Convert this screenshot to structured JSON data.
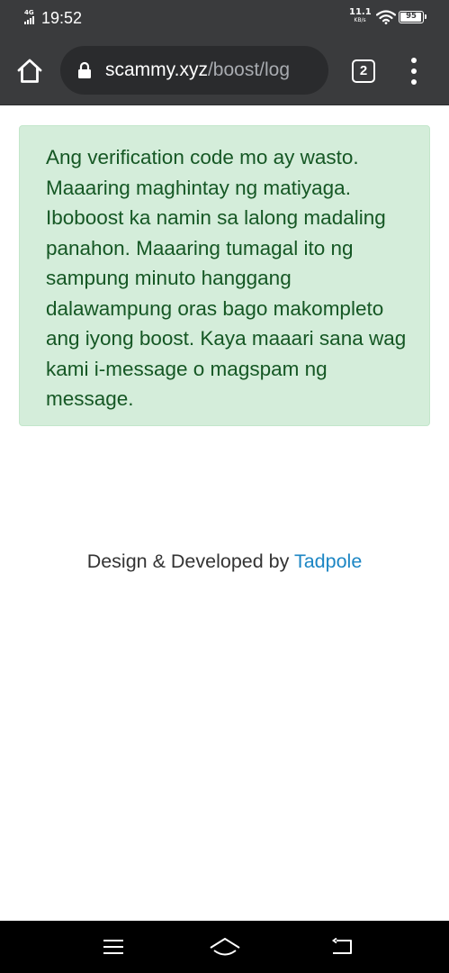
{
  "status_bar": {
    "network_type": "4G",
    "time": "19:52",
    "net_speed_value": "11.1",
    "net_speed_unit": "KB/s",
    "battery_level": "95",
    "icons": [
      "signal-icon",
      "wifi-icon",
      "battery-icon"
    ]
  },
  "browser": {
    "url_domain": "scammy.xyz",
    "url_path": "/boost/log",
    "tab_count": "2",
    "icons": [
      "home-icon",
      "lock-icon",
      "tabs-icon",
      "more-vert-icon"
    ]
  },
  "alert": {
    "message": "Ang verification code mo ay wasto. Maaaring maghintay ng matiyaga. Iboboost ka namin sa lalong madaling panahon. Maaaring tumagal ito ng sampung minuto hanggang dalawampung oras bago makompleto ang iyong boost. Kaya maaari sana wag kami i-message o magspam ng message."
  },
  "footer": {
    "credit_text": "Design & Developed by ",
    "credit_link": "Tadpole"
  },
  "nav_bar": {
    "icons": [
      "menu-icon",
      "home-icon",
      "back-icon"
    ]
  },
  "colors": {
    "browser_chrome": "#3a3b3d",
    "alert_background": "#d4edda",
    "alert_text": "#155724",
    "link": "#1c86c4"
  }
}
